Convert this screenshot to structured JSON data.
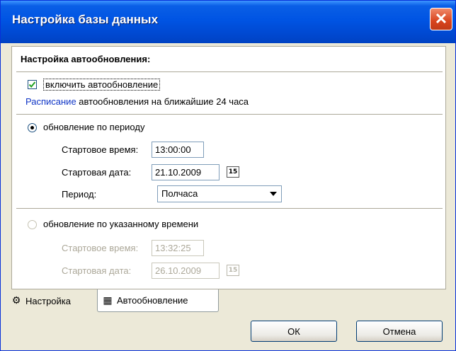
{
  "window": {
    "title": "Настройка базы данных",
    "close_symbol": "✕"
  },
  "section": {
    "title": "Настройка автообновления:"
  },
  "autoupdate": {
    "enabled_label": "включить автообновление",
    "enabled": true,
    "schedule_link": "Расписание",
    "schedule_rest": " автообновления на ближайшие 24 часа"
  },
  "by_period": {
    "label": "обновление по периоду",
    "selected": true,
    "start_time_label": "Стартовое время:",
    "start_time_value": "13:00:00",
    "start_date_label": "Стартовая дата:",
    "start_date_value": "21.10.2009",
    "period_label": "Период:",
    "period_value": "Полчаса"
  },
  "by_time": {
    "label": "обновление по указанному времени",
    "selected": false,
    "start_time_label": "Стартовое время:",
    "start_time_value": "13:32:25",
    "start_date_label": "Стартовая дата:",
    "start_date_value": "26.10.2009"
  },
  "calendar_icon_text": "15",
  "tabs": [
    {
      "label": "Настройка",
      "icon": "gear-icon",
      "active": false
    },
    {
      "label": "Автообновление",
      "icon": "schedule-icon",
      "active": true
    }
  ],
  "buttons": {
    "ok": "ОК",
    "cancel": "Отмена"
  },
  "colors": {
    "title_bar": "#0054e3",
    "link": "#0f35c6",
    "close_button": "#d8431e"
  }
}
